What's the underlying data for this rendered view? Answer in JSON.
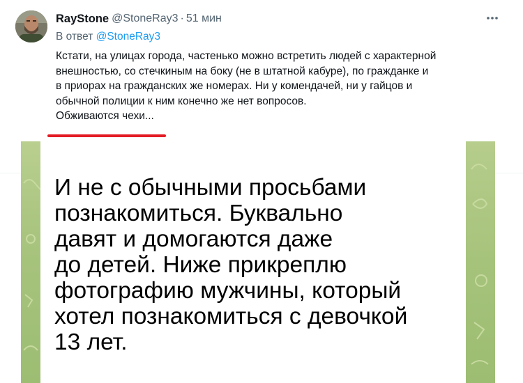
{
  "tweet": {
    "display_name": "RayStone",
    "handle": "@StoneRay3",
    "separator": "·",
    "time": "51 мин",
    "reply_prefix": "В ответ",
    "reply_to": "@StoneRay3",
    "text_lines": [
      "Кстати, на улицах города, частенько можно встретить людей с характерной",
      "внешностью, со стечкиным на боку (не в штатной кабуре), по гражданке и",
      "в приорах на гражданских же номерах. Ни у комендачей, ни у гайцов и",
      "обычной полиции к ним конечно же нет вопросов.",
      "Обживаются чехи..."
    ],
    "more_icon": "more-horizontal-icon",
    "highlight_color": "#e31b23"
  },
  "attachment": {
    "message_lines": [
      "И не с обычными просьбами",
      "познакомиться. Буквально",
      "давят и домогаются даже",
      "до детей. Ниже прикреплю",
      "фотографию мужчины, который",
      "хотел познакомиться с девочкой",
      "13 лет."
    ],
    "background_color": "#a8c47e"
  },
  "colors": {
    "link": "#1d9bf0",
    "secondary_text": "#536471",
    "primary_text": "#0f1419"
  }
}
